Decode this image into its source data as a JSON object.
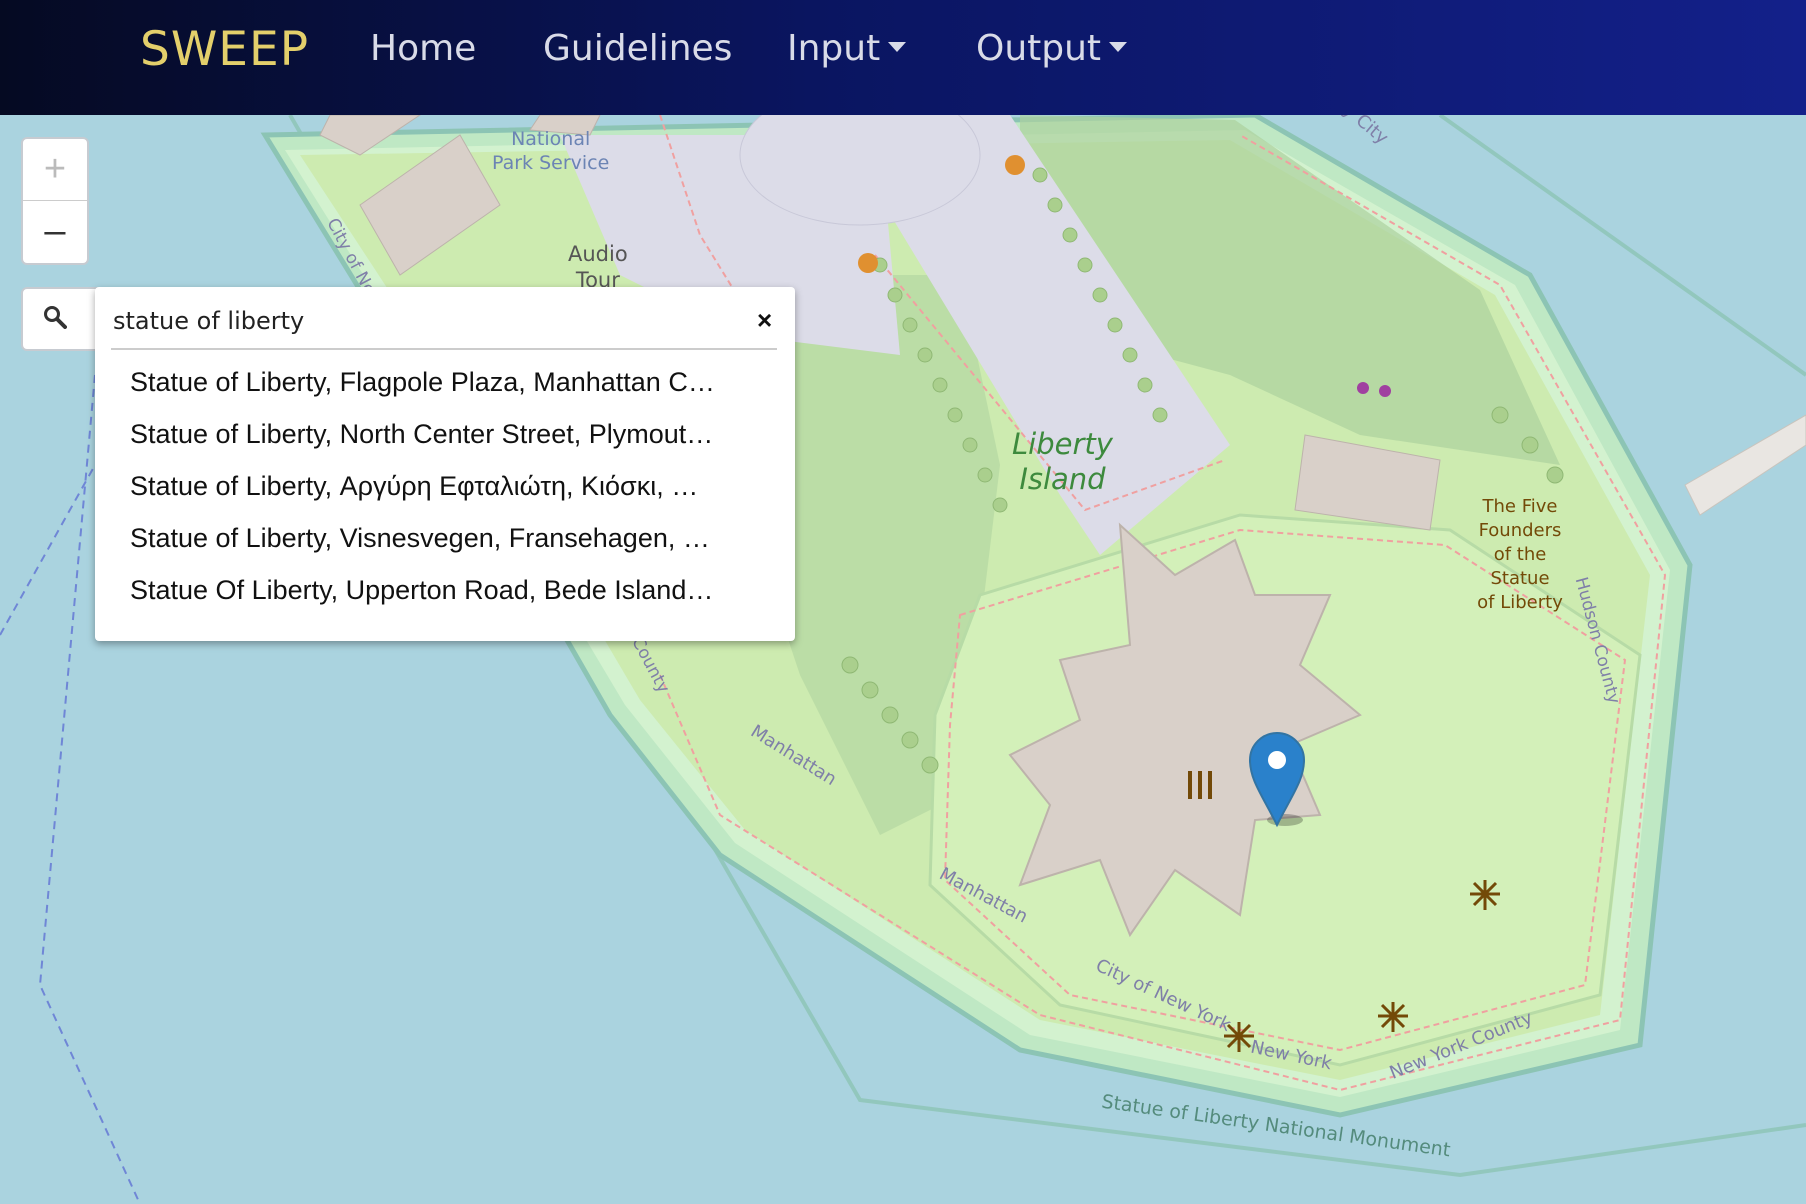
{
  "nav": {
    "brand": "SWEEP",
    "home": "Home",
    "guidelines": "Guidelines",
    "input": "Input",
    "output": "Output"
  },
  "zoom": {
    "in": "+",
    "out": "–"
  },
  "search": {
    "value": "statue of liberty",
    "clear": "×",
    "results": [
      "Statue of Liberty, Flagpole Plaza, Manhattan C…",
      "Statue of Liberty, North Center Street, Plymout…",
      "Statue of Liberty, Αργύρη Εφταλιώτη, Κιόσκι, …",
      "Statue of Liberty, Visnesvegen, Fransehagen, …",
      "Statue Of Liberty, Upperton Road, Bede Island…"
    ]
  },
  "map_labels": {
    "national_park_service": [
      "National",
      "Park Service"
    ],
    "audio_tour": [
      "Audio",
      "Tour"
    ],
    "liberty_island": [
      "Liberty",
      "Island"
    ],
    "five_founders": [
      "The Five",
      "Founders",
      "of the",
      "Statue",
      "of Liberty"
    ],
    "hudson_county": "Hudson County",
    "jersey_city": "ey City",
    "city_of_ne": "City of Ne",
    "manhattan_1": "Manhattan",
    "manhattan_2": "Manhattan",
    "city_of_new_york": "City of New York",
    "new_york": "New York",
    "new_york_county": "New York County",
    "county": "County",
    "monument": "Statue of Liberty National Monument"
  },
  "colors": {
    "water": "#aad3df",
    "park": "#cdebb0",
    "park_light": "#d9f2c4",
    "building": "#d9d0c9",
    "plaza": "#dcdce8",
    "marker": "#2a81cb",
    "nav_dark": "#050a22",
    "nav_light": "#13208a",
    "brand": "#e3cf6b"
  }
}
